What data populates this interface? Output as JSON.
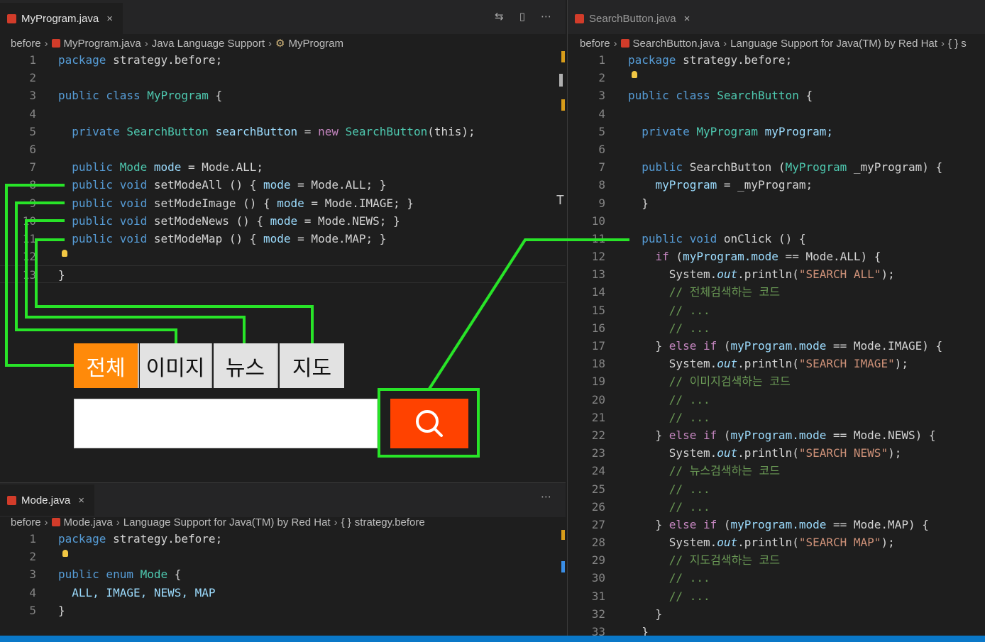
{
  "left_top": {
    "tab_title": "MyProgram.java",
    "tab_close": "×",
    "actions": [
      "⇆",
      "▯",
      "⋯"
    ],
    "breadcrumb": [
      "before",
      "MyProgram.java",
      "Java Language Support",
      "MyProgram"
    ],
    "lines": [
      {
        "n": "1"
      },
      {
        "n": "2"
      },
      {
        "n": "3"
      },
      {
        "n": "4"
      },
      {
        "n": "5"
      },
      {
        "n": "6"
      },
      {
        "n": "7"
      },
      {
        "n": "8"
      },
      {
        "n": "9"
      },
      {
        "n": "10"
      },
      {
        "n": "11"
      },
      {
        "n": "12"
      },
      {
        "n": "13"
      }
    ],
    "code": {
      "l1a": "package",
      "l1b": " strategy.before;",
      "l3a": "public class",
      "l3b": " MyProgram",
      "l3c": " {",
      "l5a": "  private",
      "l5b": " SearchButton",
      "l5c": " searchButton",
      "l5d": " = ",
      "l5e": "new",
      "l5f": " SearchButton",
      "l5g": "(this);",
      "l7a": "  public",
      "l7b": " Mode",
      "l7c": " mode",
      "l7d": " = Mode.ALL;",
      "l8a": "  public void",
      "l8b": " setModeAll () { ",
      "l8c": "mode",
      "l8d": " = Mode.ALL; }",
      "l9a": "  public void",
      "l9b": " setModeImage () { ",
      "l9c": "mode",
      "l9d": " = Mode.IMAGE; }",
      "l10a": "  public void",
      "l10b": " setModeNews () { ",
      "l10c": "mode",
      "l10d": " = Mode.NEWS; }",
      "l11a": "  public void",
      "l11b": " setModeMap () { ",
      "l11c": "mode",
      "l11d": " = Mode.MAP; }",
      "l13": "}"
    }
  },
  "mode_tabs": [
    "전체",
    "이미지",
    "뉴스",
    "지도"
  ],
  "left_bottom": {
    "tab_title": "Mode.java",
    "tab_close": "×",
    "actions": [
      "⋯"
    ],
    "breadcrumb": [
      "before",
      "Mode.java",
      "Language Support for Java(TM) by Red Hat",
      "{ }",
      "strategy.before"
    ],
    "lines": [
      {
        "n": "1"
      },
      {
        "n": "2"
      },
      {
        "n": "3"
      },
      {
        "n": "4"
      },
      {
        "n": "5"
      }
    ],
    "code": {
      "l1a": "package",
      "l1b": " strategy.before;",
      "l3a": "public enum",
      "l3b": " Mode",
      "l3c": " {",
      "l4": "  ALL, IMAGE, NEWS, MAP",
      "l5": "}"
    }
  },
  "right": {
    "tab_title": "SearchButton.java",
    "tab_close": "×",
    "breadcrumb": [
      "before",
      "SearchButton.java",
      "Language Support for Java(TM) by Red Hat",
      "{ } s"
    ],
    "lines": [
      {
        "n": "1"
      },
      {
        "n": "2"
      },
      {
        "n": "3"
      },
      {
        "n": "4"
      },
      {
        "n": "5"
      },
      {
        "n": "6"
      },
      {
        "n": "7"
      },
      {
        "n": "8"
      },
      {
        "n": "9"
      },
      {
        "n": "10"
      },
      {
        "n": "11"
      },
      {
        "n": "12"
      },
      {
        "n": "13"
      },
      {
        "n": "14"
      },
      {
        "n": "15"
      },
      {
        "n": "16"
      },
      {
        "n": "17"
      },
      {
        "n": "18"
      },
      {
        "n": "19"
      },
      {
        "n": "20"
      },
      {
        "n": "21"
      },
      {
        "n": "22"
      },
      {
        "n": "23"
      },
      {
        "n": "24"
      },
      {
        "n": "25"
      },
      {
        "n": "26"
      },
      {
        "n": "27"
      },
      {
        "n": "28"
      },
      {
        "n": "29"
      },
      {
        "n": "30"
      },
      {
        "n": "31"
      },
      {
        "n": "32"
      },
      {
        "n": "33"
      }
    ],
    "code": {
      "l1a": "package",
      "l1b": " strategy.before;",
      "l3a": "public class",
      "l3b": " SearchButton",
      "l3c": " {",
      "l5a": "  private",
      "l5b": " MyProgram",
      "l5c": " myProgram;",
      "l7a": "  public",
      "l7b": " SearchButton (",
      "l7c": "MyProgram",
      "l7d": " _myProgram) {",
      "l8a": "    myProgram",
      "l8b": " = _myProgram;",
      "l9": "  }",
      "l11a": "  public void",
      "l11b": " onClick () {",
      "l12a": "    if",
      "l12b": " (",
      "l12c": "myProgram.mode",
      "l12d": " == Mode.ALL) {",
      "l13a": "      System.",
      "l13b": "out",
      "l13c": ".println(",
      "l13d": "\"SEARCH ALL\"",
      "l13e": ");",
      "l14": "      // 전체검색하는 코드",
      "l15": "      // ...",
      "l16": "      // ...",
      "l17a": "    } ",
      "l17b": "else if",
      "l17c": " (",
      "l17d": "myProgram.mode",
      "l17e": " == Mode.IMAGE) {",
      "l18a": "      System.",
      "l18b": "out",
      "l18c": ".println(",
      "l18d": "\"SEARCH IMAGE\"",
      "l18e": ");",
      "l19": "      // 이미지검색하는 코드",
      "l20": "      // ...",
      "l21": "      // ...",
      "l22a": "    } ",
      "l22b": "else if",
      "l22c": " (",
      "l22d": "myProgram.mode",
      "l22e": " == Mode.NEWS) {",
      "l23a": "      System.",
      "l23b": "out",
      "l23c": ".println(",
      "l23d": "\"SEARCH NEWS\"",
      "l23e": ");",
      "l24": "      // 뉴스검색하는 코드",
      "l25": "      // ...",
      "l26": "      // ...",
      "l27a": "    } ",
      "l27b": "else if",
      "l27c": " (",
      "l27d": "myProgram.mode",
      "l27e": " == Mode.MAP) {",
      "l28a": "      System.",
      "l28b": "out",
      "l28c": ".println(",
      "l28d": "\"SEARCH MAP\"",
      "l28e": ");",
      "l29": "      // 지도검색하는 코드",
      "l30": "      // ...",
      "l31": "      // ...",
      "l32": "    }",
      "l33": "  }"
    }
  },
  "colors": {
    "active_mode": "#ff8a0a",
    "search_button": "#ff4200",
    "connector": "#28e428",
    "statusbar": "#0a78c8"
  },
  "icons": {
    "search_button_icon": "search-icon",
    "lightbulb": "lightbulb-icon",
    "java_file": "java-file-icon"
  }
}
